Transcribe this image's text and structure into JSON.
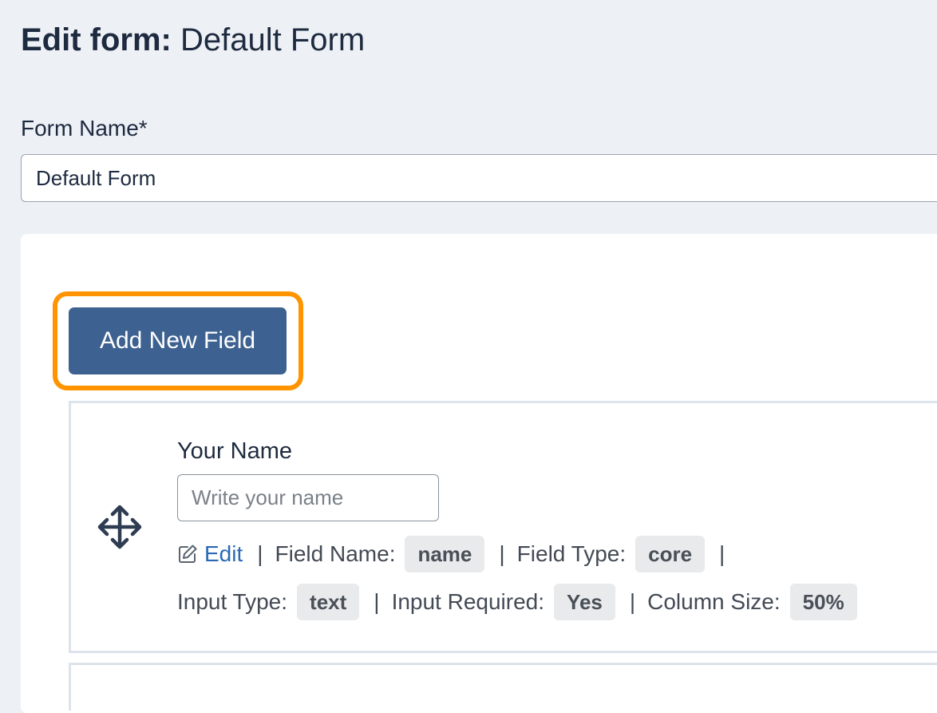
{
  "header": {
    "title_label": "Edit form:",
    "title_value": "Default Form"
  },
  "form": {
    "name_label": "Form Name*",
    "name_value": "Default Form"
  },
  "panel": {
    "add_button_label": "Add New Field"
  },
  "field": {
    "label": "Your Name",
    "placeholder": "Write your name",
    "edit_label": "Edit",
    "separator": "|",
    "field_name_label": "Field Name:",
    "field_name_value": "name",
    "field_type_label": "Field Type:",
    "field_type_value": "core",
    "input_type_label": "Input Type:",
    "input_type_value": "text",
    "input_required_label": "Input Required:",
    "input_required_value": "Yes",
    "column_size_label": "Column Size:",
    "column_size_value": "50%"
  },
  "icons": {
    "drag": "move-arrows-icon",
    "edit": "pencil-square-icon"
  },
  "colors": {
    "page_background": "#edf1f6",
    "primary_button": "#3d6190",
    "highlight_ring": "#ff9400",
    "link": "#2a69b5",
    "tag_background": "#e9eaec"
  }
}
